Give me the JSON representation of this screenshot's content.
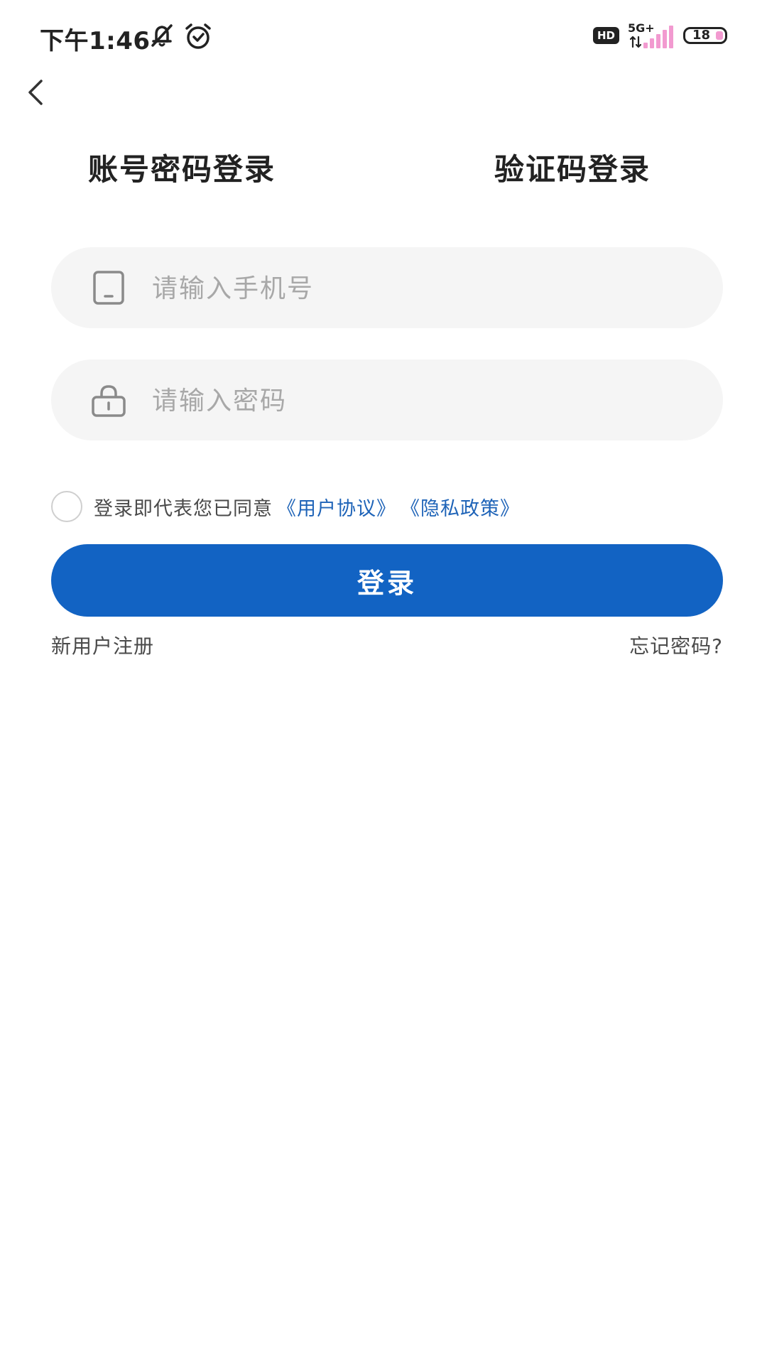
{
  "status_bar": {
    "time": "下午1:46",
    "hd_badge": "HD",
    "network": "5G+",
    "battery": "18",
    "colors": {
      "text": "#222222",
      "signal": "#f29ad0",
      "battery_fill": "#f29ad0"
    },
    "icons": [
      "bell-off-icon",
      "alarm-icon",
      "hd-icon",
      "signal-icon",
      "battery-icon"
    ]
  },
  "nav": {
    "back_icon": "chevron-left-icon"
  },
  "tabs": [
    {
      "label": "账号密码登录"
    },
    {
      "label": "验证码登录"
    }
  ],
  "form": {
    "phone": {
      "placeholder": "请输入手机号",
      "value": "",
      "icon": "phone-icon"
    },
    "password": {
      "placeholder": "请输入密码",
      "value": "",
      "icon": "lock-icon"
    }
  },
  "agreement": {
    "text": "登录即代表您已同意",
    "user_agreement": "《用户协议》",
    "privacy_policy": "《隐私政策》",
    "checked": false,
    "link_color": "#1f64b8"
  },
  "login_button": {
    "label": "登录",
    "color": "#1263c3"
  },
  "links": {
    "register": "新用户注册",
    "forgot": "忘记密码?"
  }
}
